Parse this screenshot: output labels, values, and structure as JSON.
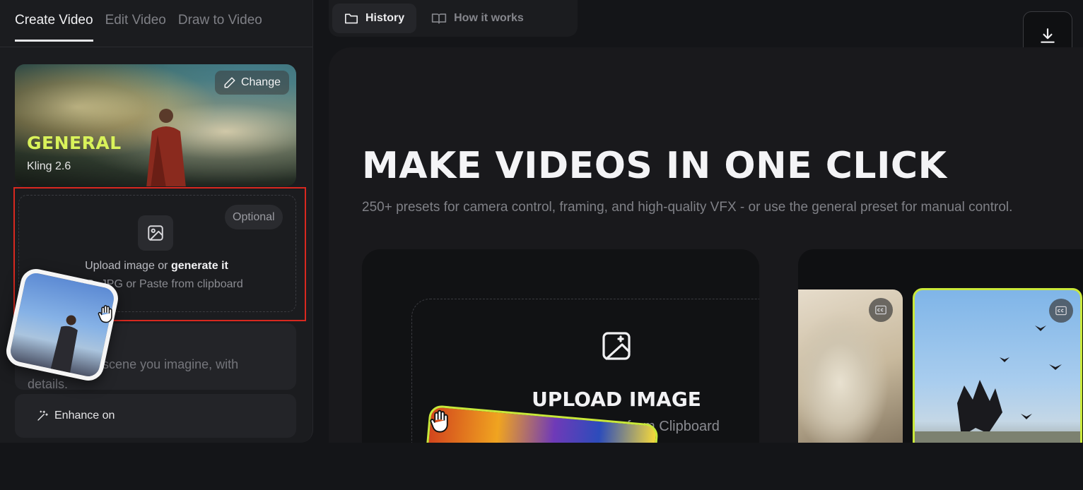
{
  "left_panel": {
    "tabs": [
      {
        "label": "Create Video",
        "active": true
      },
      {
        "label": "Edit Video",
        "active": false
      },
      {
        "label": "Draw to Video",
        "active": false
      }
    ],
    "preset": {
      "title": "GENERAL",
      "model": "Kling 2.6",
      "change_label": "Change"
    },
    "upload": {
      "optional_label": "Optional",
      "line1_prefix": "Upload image or ",
      "line1_link": "generate it",
      "line2": "PNG, JPG or Paste from clipboard"
    },
    "prompt": {
      "placeholder": "Describe the scene you imagine, with details."
    },
    "enhance": {
      "label": "Enhance on"
    }
  },
  "top_tabs": [
    {
      "label": "History",
      "icon": "folder-icon",
      "active": true
    },
    {
      "label": "How it works",
      "icon": "book-icon",
      "active": false
    }
  ],
  "main": {
    "title": "MAKE VIDEOS IN ONE CLICK",
    "subtitle": "250+ presets for camera control, framing, and high-quality VFX - or use the general preset for manual control.",
    "upload_card": {
      "title": "UPLOAD IMAGE",
      "subtitle": "Paste from Clipboard"
    }
  },
  "colors": {
    "accent": "#d9f25a",
    "highlight_border": "#d8281f",
    "background": "#141518"
  }
}
